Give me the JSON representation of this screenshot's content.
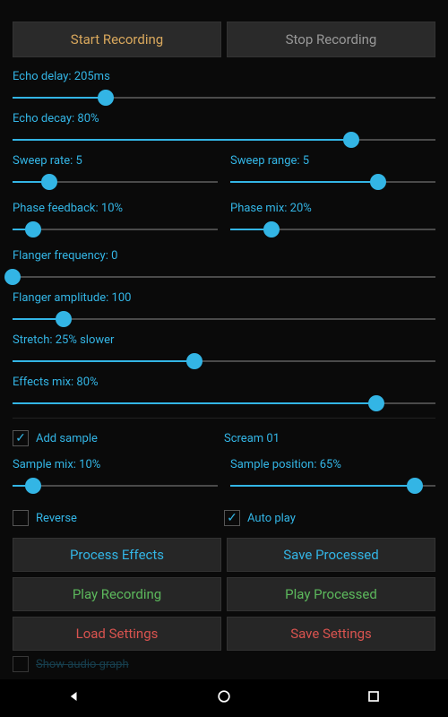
{
  "buttons": {
    "start": "Start Recording",
    "stop": "Stop Recording",
    "process": "Process Effects",
    "save_processed": "Save Processed",
    "play_recording": "Play Recording",
    "play_processed": "Play Processed",
    "load_settings": "Load Settings",
    "save_settings": "Save Settings"
  },
  "sliders": {
    "echo_delay": {
      "label": "Echo delay: 205ms",
      "pct": 22
    },
    "echo_decay": {
      "label": "Echo decay: 80%",
      "pct": 80
    },
    "sweep_rate": {
      "label": "Sweep rate: 5",
      "pct": 18
    },
    "sweep_range": {
      "label": "Sweep range: 5",
      "pct": 72
    },
    "phase_feedback": {
      "label": "Phase feedback: 10%",
      "pct": 10
    },
    "phase_mix": {
      "label": "Phase mix: 20%",
      "pct": 20
    },
    "flanger_freq": {
      "label": "Flanger frequency: 0",
      "pct": 0
    },
    "flanger_amp": {
      "label": "Flanger amplitude: 100",
      "pct": 12
    },
    "stretch": {
      "label": "Stretch: 25% slower",
      "pct": 43
    },
    "effects_mix": {
      "label": "Effects mix: 80%",
      "pct": 86
    },
    "sample_mix": {
      "label": "Sample mix: 10%",
      "pct": 10
    },
    "sample_pos": {
      "label": "Sample position: 65%",
      "pct": 90
    }
  },
  "checks": {
    "add_sample": "Add sample",
    "reverse": "Reverse",
    "auto_play": "Auto play",
    "show_graph": "Show audio graph"
  },
  "sample_name": "Scream 01"
}
